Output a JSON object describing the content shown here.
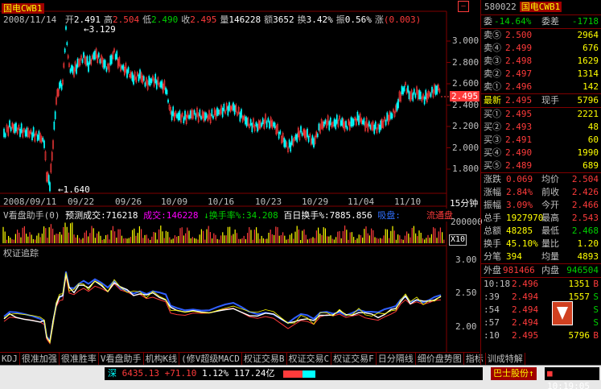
{
  "stock": {
    "name": "国电CWB1",
    "code": "580022",
    "date": "2008/11/14"
  },
  "ohlc_line": [
    {
      "label": "开",
      "value": "2.491",
      "color": "#ffffff"
    },
    {
      "label": "高",
      "value": "2.504",
      "color": "#ff3b3b"
    },
    {
      "label": "低",
      "value": "2.490",
      "color": "#00d000"
    },
    {
      "label": "收",
      "value": "2.495",
      "color": "#ff3b3b"
    },
    {
      "label": "量",
      "value": "146228",
      "color": "#ffffff"
    },
    {
      "label": "额",
      "value": "3652",
      "color": "#ffffff"
    },
    {
      "label": "换",
      "value": "3.42%",
      "color": "#ffffff"
    },
    {
      "label": "振",
      "value": "0.56%",
      "color": "#ffffff"
    },
    {
      "label": "涨",
      "value": "(0.003)",
      "color": "#ff3b3b"
    }
  ],
  "markers": {
    "high": "3.129",
    "low": "1.640",
    "current": "2.495"
  },
  "price_axis": [
    "3.000",
    "2.800",
    "2.600",
    "2.400",
    "2.200",
    "2.000",
    "1.800"
  ],
  "date_axis": [
    "2008/09/11",
    "09/22",
    "09/26",
    "10/09",
    "10/16",
    "10/23",
    "10/29",
    "11/04",
    "11/10"
  ],
  "period_label": "15分钟",
  "volume_panel": {
    "title": "V看盘助手(0)",
    "forecast_label": "预测成交:",
    "forecast_value": "716218",
    "vol_label": "成交:",
    "vol_value": "146228",
    "turnover_label": "换手率%:",
    "turnover_value": "34.208",
    "hundred_label": "百日换手%:",
    "hundred_value": "7885.856",
    "inflow_label": "吸盘:",
    "outflow_label": "流通盘",
    "axis_label": "200000",
    "multiplier": "X10"
  },
  "indicator_panel": {
    "title": "权证追踪",
    "axis": [
      "3.00",
      "2.50",
      "2.00"
    ]
  },
  "tabs": [
    "KDJ",
    "很准加强",
    "很准胜率",
    "V看盘助手",
    "机构K线",
    "(修V超级MACD",
    "权证交易B",
    "权证交易C",
    "权证交易F",
    "日分隔线",
    "细价盘势图",
    "指标",
    "训成特解"
  ],
  "right_panel": {
    "header_code": "580022",
    "header_name": "国电CWB1",
    "commit_ratio_label": "委",
    "commit_ratio": "-14.64%",
    "commit_diff_label": "委差",
    "commit_diff": "-1718",
    "asks": [
      {
        "label": "卖⑤",
        "price": "2.500",
        "vol": "2964"
      },
      {
        "label": "卖④",
        "price": "2.499",
        "vol": "676"
      },
      {
        "label": "卖③",
        "price": "2.498",
        "vol": "1629"
      },
      {
        "label": "卖②",
        "price": "2.497",
        "vol": "1314"
      },
      {
        "label": "卖①",
        "price": "2.496",
        "vol": "142"
      }
    ],
    "last": {
      "label": "最新",
      "price": "2.495",
      "vol_label": "现手",
      "vol": "5796"
    },
    "bids": [
      {
        "label": "买①",
        "price": "2.495",
        "vol": "2221"
      },
      {
        "label": "买②",
        "price": "2.493",
        "vol": "48"
      },
      {
        "label": "买③",
        "price": "2.491",
        "vol": "60"
      },
      {
        "label": "买④",
        "price": "2.490",
        "vol": "1990"
      },
      {
        "label": "买⑤",
        "price": "2.489",
        "vol": "689"
      }
    ],
    "stats": [
      {
        "l1": "涨跌",
        "v1": "0.069",
        "l2": "均价",
        "v2": "2.504"
      },
      {
        "l1": "涨幅",
        "v1": "2.84%",
        "l2": "前收",
        "v2": "2.426"
      },
      {
        "l1": "振幅",
        "v1": "3.09%",
        "l2": "今开",
        "v2": "2.466"
      },
      {
        "l1": "总手",
        "v1": "1927970",
        "l2": "最高",
        "v2": "2.543"
      },
      {
        "l1": "总额",
        "v1": "48285",
        "l2": "最低",
        "v2": "2.468"
      },
      {
        "l1": "换手",
        "v1": "45.10%",
        "l2": "量比",
        "v2": "1.20"
      },
      {
        "l1": "分笔",
        "v1": "394",
        "l2": "均量",
        "v2": "4893"
      }
    ],
    "outer_label": "外盘",
    "outer": "981466",
    "inner_label": "内盘",
    "inner": "946504",
    "ticks": [
      {
        "time": "10:18",
        "price": "2.496",
        "vol": "1351",
        "side": "B"
      },
      {
        "time": ":39",
        "price": "2.494",
        "vol": "1557",
        "side": "S"
      },
      {
        "time": ":54",
        "price": "2.494",
        "vol": "",
        "side": "S"
      },
      {
        "time": ":57",
        "price": "2.494",
        "vol": "",
        "side": "S"
      },
      {
        "time": ":10",
        "price": "2.495",
        "vol": "5796",
        "side": "B"
      }
    ]
  },
  "statusbar": {
    "index_label": "深",
    "index_value": "6435.13",
    "index_change": "+71.10",
    "index_pct": "1.12%",
    "index_amount": "117.24亿",
    "badge": "巴士股份↑",
    "time": "10:19:05"
  },
  "colors": {
    "up": "#ff3b3b",
    "down": "#00d000",
    "frame": "#800000",
    "badge": "#a00000"
  }
}
